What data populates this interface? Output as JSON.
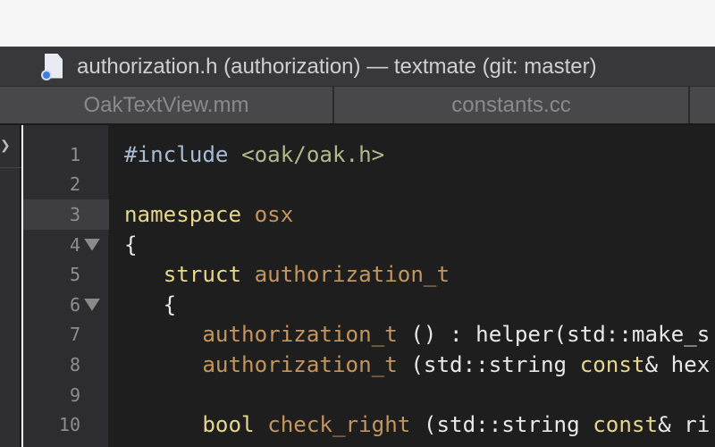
{
  "window": {
    "title": "authorization.h (authorization) — textmate (git: master)",
    "icon": "header-file-icon"
  },
  "tabs": [
    {
      "label": "OakTextView.mm"
    },
    {
      "label": "constants.cc"
    }
  ],
  "colors": {
    "keyword": "#e6d68a",
    "entity": "#c4955c",
    "string": "#b3b88a",
    "preproc": "#a8bcd4",
    "plain": "#e8e8e8"
  },
  "editor": {
    "current_line": 3,
    "lines": [
      {
        "n": "1",
        "fold": false,
        "tokens": [
          {
            "t": "#include",
            "c": "preproc"
          },
          {
            "t": " ",
            "c": "plain"
          },
          {
            "t": "<oak/oak.h>",
            "c": "string"
          }
        ]
      },
      {
        "n": "2",
        "fold": false,
        "tokens": []
      },
      {
        "n": "3",
        "fold": false,
        "tokens": [
          {
            "t": "namespace",
            "c": "keyword"
          },
          {
            "t": " ",
            "c": "plain"
          },
          {
            "t": "osx",
            "c": "entity"
          }
        ]
      },
      {
        "n": "4",
        "fold": true,
        "tokens": [
          {
            "t": "{",
            "c": "plain"
          }
        ]
      },
      {
        "n": "5",
        "fold": false,
        "tokens": [
          {
            "t": "   ",
            "c": "plain"
          },
          {
            "t": "struct",
            "c": "keyword"
          },
          {
            "t": " ",
            "c": "plain"
          },
          {
            "t": "authorization_t",
            "c": "entity"
          }
        ]
      },
      {
        "n": "6",
        "fold": true,
        "tokens": [
          {
            "t": "   {",
            "c": "plain"
          }
        ]
      },
      {
        "n": "7",
        "fold": false,
        "tokens": [
          {
            "t": "      ",
            "c": "plain"
          },
          {
            "t": "authorization_t",
            "c": "entity"
          },
          {
            "t": " () : helper(std::make_s",
            "c": "plain"
          }
        ]
      },
      {
        "n": "8",
        "fold": false,
        "tokens": [
          {
            "t": "      ",
            "c": "plain"
          },
          {
            "t": "authorization_t",
            "c": "entity"
          },
          {
            "t": " (std::string ",
            "c": "plain"
          },
          {
            "t": "const",
            "c": "keyword"
          },
          {
            "t": "& hex",
            "c": "plain"
          }
        ]
      },
      {
        "n": "9",
        "fold": false,
        "tokens": []
      },
      {
        "n": "10",
        "fold": false,
        "tokens": [
          {
            "t": "      ",
            "c": "plain"
          },
          {
            "t": "bool",
            "c": "keyword"
          },
          {
            "t": " ",
            "c": "plain"
          },
          {
            "t": "check_right",
            "c": "entity"
          },
          {
            "t": " (std::string ",
            "c": "plain"
          },
          {
            "t": "const",
            "c": "keyword"
          },
          {
            "t": "& ri",
            "c": "plain"
          }
        ]
      }
    ]
  }
}
